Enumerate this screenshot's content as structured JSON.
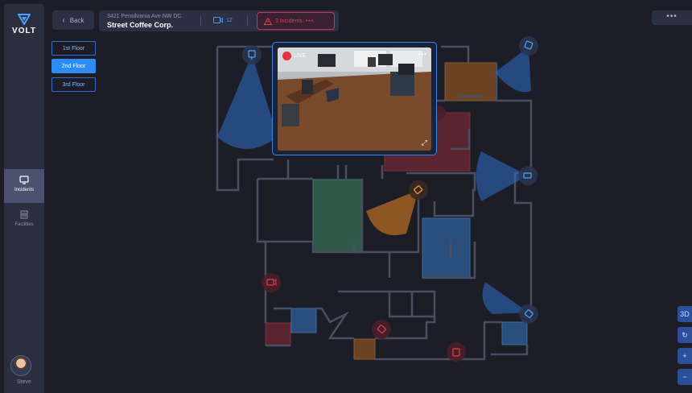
{
  "app": {
    "brand": "VOLT"
  },
  "sidebar": {
    "items": [
      {
        "label": "Incidents",
        "icon": "monitor-icon",
        "active": true
      },
      {
        "label": "Facilities",
        "icon": "building-icon",
        "active": false
      }
    ],
    "user": {
      "name": "Steve"
    }
  },
  "header": {
    "back_label": "Back",
    "address": "3421 Pensilvania Ave NW DC",
    "business": "Street Coffee Corp.",
    "camera_count": "12",
    "incidents_label": "3 Incidents",
    "more_label": "•••"
  },
  "floors": [
    {
      "label": "1st Floor",
      "active": false
    },
    {
      "label": "2nd Floor",
      "active": true
    },
    {
      "label": "3rd Floor",
      "active": false
    }
  ],
  "map_controls": {
    "view_3d": "3D",
    "rotate": "↻",
    "zoom_in": "+",
    "zoom_out": "−"
  },
  "video": {
    "live_label": "LIVE",
    "more_label": "•••",
    "expand_icon": "expand-icon"
  },
  "colors": {
    "accent": "#2e8bf3",
    "alert": "#e0404f",
    "orange_camera": "#e7851e",
    "room_red": "#5a2430",
    "room_green": "#2f5a4a",
    "room_blue": "#2b4f7c",
    "room_orange": "#6a4325"
  }
}
